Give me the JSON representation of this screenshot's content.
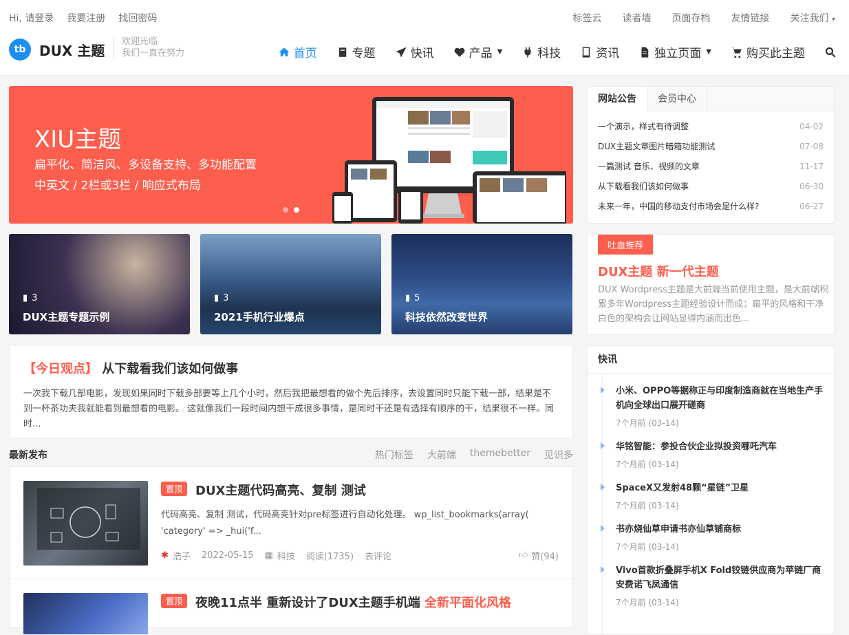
{
  "topbar": {
    "left": [
      "Hi, 请登录",
      "我要注册",
      "找回密码"
    ],
    "right": [
      "标签云",
      "读者墙",
      "页面存档",
      "友情链接",
      "关注我们"
    ]
  },
  "brand": {
    "logo_letters": "tb",
    "name": "DUX 主题",
    "slogan_1": "欢迎光临",
    "slogan_2": "我们一直在努力"
  },
  "nav": [
    {
      "label": "首页",
      "icon": "home-icon",
      "active": true
    },
    {
      "label": "专题",
      "icon": "book-icon"
    },
    {
      "label": "快讯",
      "icon": "paper-plane-icon"
    },
    {
      "label": "产品",
      "icon": "heart-icon",
      "dropdown": true
    },
    {
      "label": "科技",
      "icon": "plug-icon"
    },
    {
      "label": "资讯",
      "icon": "tablet-icon"
    },
    {
      "label": "独立页面",
      "icon": "file-icon",
      "dropdown": true
    },
    {
      "label": "购买此主题",
      "icon": "cart-icon"
    }
  ],
  "banner": {
    "title": "XIU主题",
    "line1": "扁平化、简洁风、多设备支持、多功能配置",
    "line2": "中英文 / 2栏或3栏 / 响应式布局",
    "bg": "#fe5e4e"
  },
  "cards": [
    {
      "count": "3",
      "title": "DUX主题专题示例"
    },
    {
      "count": "3",
      "title": "2021手机行业爆点"
    },
    {
      "count": "5",
      "title": "科技依然改变世界"
    }
  ],
  "opinion": {
    "tag": "【今日观点】",
    "title": "从下载看我们该如何做事",
    "text": "一次我下载几部电影，发现如果同时下载多部要等上几个小时，然后我把最想看的做个先后排序，去设置同时只能下载一部，结果是不到一杯茶功夫我就能看到最想看的电影。 这就像我们一段时间内想干成很多事情，是同时干还是有选择有顺序的干，结果很不一样。同时..."
  },
  "latest": {
    "title": "最新发布",
    "tags": [
      "热门标签",
      "大前端",
      "themebetter",
      "见识多"
    ]
  },
  "posts": [
    {
      "sticky": "置顶",
      "title": "DUX主题代码高亮、复制 测试",
      "excerpt": "代码高亮、复制 测试，代码高亮针对pre标签进行自动化处理。 wp_list_bookmarks(array( 'category' => _hui('f...",
      "author": "浩子",
      "date": "2022-05-15",
      "category": "科技",
      "views": "阅读(1735)",
      "comment": "去评论",
      "likes": "赞(94)"
    },
    {
      "sticky": "置顶",
      "title": "夜晚11点半 重新设计了DUX主题手机端",
      "title_hl": "全新平面化风格"
    }
  ],
  "notice": {
    "tabs": [
      "网站公告",
      "会员中心"
    ],
    "items": [
      {
        "text": "一个演示，样式有待调整",
        "date": "04-02"
      },
      {
        "text": "DUX主题文章图片暗箱功能测试",
        "date": "07-08"
      },
      {
        "text": "一篇测试 音乐、视频的文章",
        "date": "11-17"
      },
      {
        "text": "从下载看我们该如何做事",
        "date": "06-30"
      },
      {
        "text": "未来一年，中国的移动支付市场会是什么样?",
        "date": "06-27"
      }
    ]
  },
  "recommend": {
    "badge": "吐血推荐",
    "title": "DUX主题 新一代主题",
    "text": "DUX Wordpress主题是大前端当前使用主题，是大前端积累多年Wordpress主题经验设计而成；扁平的风格和干净白色的架构会让网站显得内涵而出色..."
  },
  "flash": {
    "title": "快讯",
    "items": [
      {
        "title": "小米、OPPO等据称正与印度制造商就在当地生产手机向全球出口展开磋商",
        "time": "7个月前 (03-14)"
      },
      {
        "title": "华铭智能：参投合伙企业拟投资哪吒汽车",
        "time": "7个月前 (03-14)"
      },
      {
        "title": "SpaceX又发射48颗“星链”卫星",
        "time": "7个月前 (03-14)"
      },
      {
        "title": "书亦烧仙草申请书亦仙草铺商标",
        "time": "7个月前 (03-14)"
      },
      {
        "title": "Vivo首款折叠屏手机X Fold铰链供应商为苹链厂商安费诺飞凤通信",
        "time": "7个月前 (03-14)"
      }
    ]
  }
}
